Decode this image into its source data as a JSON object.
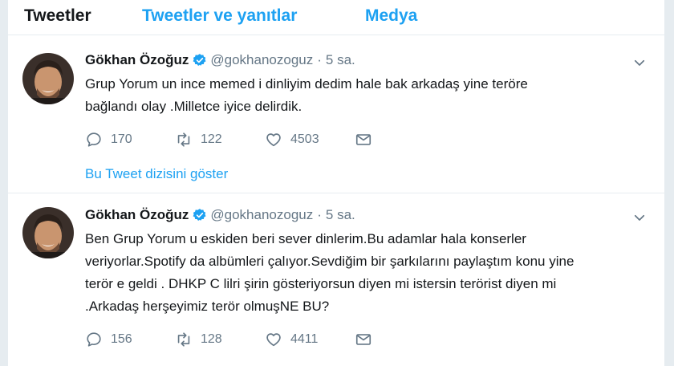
{
  "tabs": [
    {
      "label": "Tweetler"
    },
    {
      "label": "Tweetler ve yanıtlar"
    },
    {
      "label": "Medya"
    }
  ],
  "tweets": [
    {
      "name": "Gökhan Özoğuz",
      "handle": "@gokhanozoguz",
      "time": "5 sa.",
      "lines": [
        "Grup Yorum un ince memed i dinliyim dedim hale bak arkadaş yine teröre",
        "bağlandı olay .Milletce iyice delirdik."
      ],
      "replies": "170",
      "retweets": "122",
      "likes": "4503",
      "thread_link": "Bu Tweet dizisini göster"
    },
    {
      "name": "Gökhan Özoğuz",
      "handle": "@gokhanozoguz",
      "time": "5 sa.",
      "lines": [
        "Ben Grup Yorum u eskiden beri sever dinlerim.Bu adamlar hala konserler",
        "veriyorlar.Spotify da albümleri çalıyor.Sevdiğim bir şarkılarını paylaştım konu yine",
        "terör e geldi . DHKP C lilri şirin gösteriyorsun diyen mi istersin terörist diyen mi",
        ".Arkadaş herşeyimiz terör olmuşNE BU?"
      ],
      "replies": "156",
      "retweets": "128",
      "likes": "4411"
    }
  ],
  "icons": {
    "verified": "verified-badge-icon",
    "reply": "reply-icon",
    "retweet": "retweet-icon",
    "like": "heart-icon",
    "message": "envelope-icon",
    "caret": "chevron-down-icon"
  },
  "colors": {
    "accent": "#1da1f2",
    "secondary_text": "#657786",
    "divider": "#e6ecf0"
  }
}
